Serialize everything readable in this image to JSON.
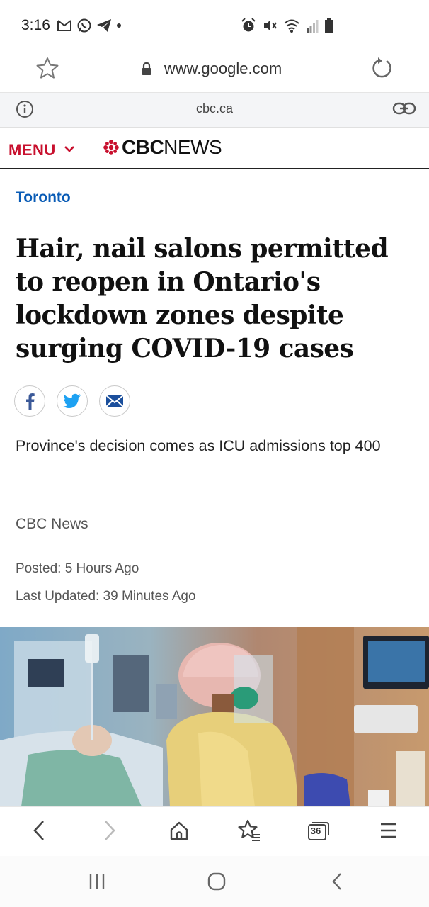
{
  "status_bar": {
    "time": "3:16"
  },
  "browser": {
    "url": "www.google.com",
    "site": "cbc.ca",
    "tab_count": "36"
  },
  "site_header": {
    "menu_label": "MENU",
    "brand_cbc": "CBC",
    "brand_news": "NEWS"
  },
  "article": {
    "section": "Toronto",
    "headline": "Hair, nail salons permitted to reopen in Ontario's lockdown zones despite surging COVID-19 cases",
    "deck": "Province's decision comes as ICU admissions top 400",
    "byline": "CBC News",
    "posted": "Posted: 5 Hours Ago",
    "updated": "Last Updated: 39 Minutes Ago"
  },
  "colors": {
    "cbc_red": "#c8102e",
    "section_blue": "#0a5cb6",
    "facebook_blue": "#3b5998",
    "twitter_blue": "#1da1f2",
    "email_blue": "#1b4f9c"
  },
  "icons": {
    "status_left": [
      "gmail-icon",
      "whatsapp-icon",
      "telegram-icon",
      "dot-icon"
    ],
    "status_right": [
      "alarm-icon",
      "mute-icon",
      "wifi-icon",
      "signal-icon",
      "battery-icon"
    ],
    "toolbar": [
      "back-icon",
      "forward-icon",
      "home-icon",
      "bookmarks-icon",
      "tabs-icon",
      "menu-icon"
    ],
    "system_nav": [
      "recents-icon",
      "home-circle-icon",
      "back-chevron-icon"
    ]
  }
}
